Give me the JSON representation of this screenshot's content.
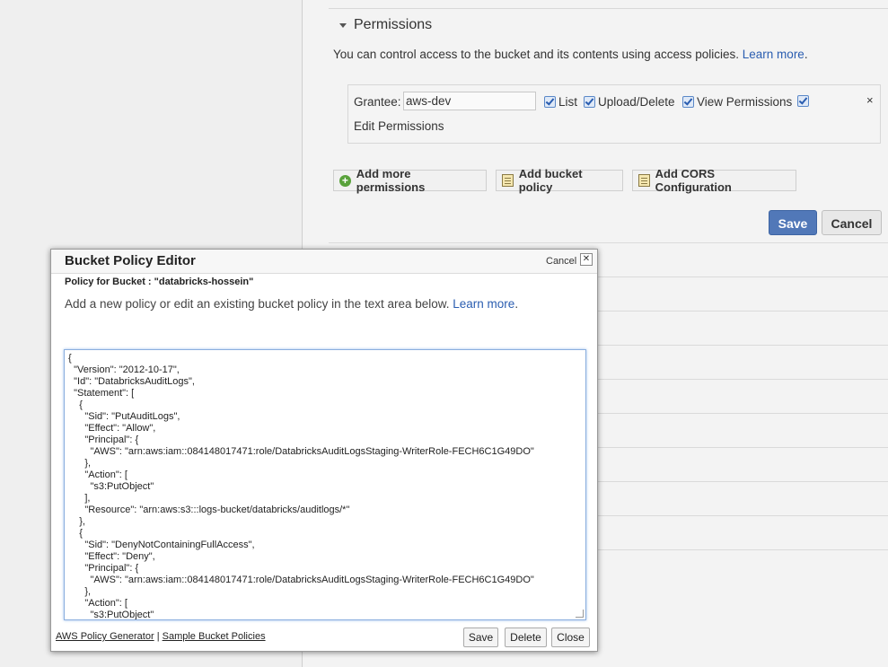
{
  "permissions": {
    "header": "Permissions",
    "description": "You can control access to the bucket and its contents using access policies.",
    "learn_more": "Learn more",
    "grantee": {
      "label": "Grantee:",
      "value": "aws-dev",
      "checkboxes": [
        {
          "label": "List",
          "checked": true
        },
        {
          "label": "Upload/Delete",
          "checked": true
        },
        {
          "label": "View Permissions",
          "checked": true
        },
        {
          "label": "Edit Permissions",
          "checked": true
        }
      ],
      "remove": "×"
    },
    "buttons": {
      "add_more": "Add more permissions",
      "add_policy": "Add bucket policy",
      "add_cors": "Add CORS Configuration",
      "save": "Save",
      "cancel": "Cancel"
    }
  },
  "modal": {
    "title": "Bucket Policy Editor",
    "cancel": "Cancel",
    "close_x": "✕",
    "policy_for": "Policy for Bucket : \"databricks-hossein\"",
    "description": "Add a new policy or edit an existing bucket policy in the text area below.",
    "learn_more": "Learn more",
    "policy_text": "{\n  \"Version\": \"2012-10-17\",\n  \"Id\": \"DatabricksAuditLogs\",\n  \"Statement\": [\n    {\n      \"Sid\": \"PutAuditLogs\",\n      \"Effect\": \"Allow\",\n      \"Principal\": {\n        \"AWS\": \"arn:aws:iam::084148017471:role/DatabricksAuditLogsStaging-WriterRole-FECH6C1G49DO\"\n      },\n      \"Action\": [\n        \"s3:PutObject\"\n      ],\n      \"Resource\": \"arn:aws:s3:::logs-bucket/databricks/auditlogs/*\"\n    },\n    {\n      \"Sid\": \"DenyNotContainingFullAccess\",\n      \"Effect\": \"Deny\",\n      \"Principal\": {\n        \"AWS\": \"arn:aws:iam::084148017471:role/DatabricksAuditLogsStaging-WriterRole-FECH6C1G49DO\"\n      },\n      \"Action\": [\n        \"s3:PutObject\"",
    "footer": {
      "policy_generator": "AWS Policy Generator",
      "separator": "|",
      "sample_policies": "Sample Bucket Policies"
    },
    "buttons": {
      "save": "Save",
      "delete": "Delete",
      "close": "Close"
    }
  },
  "colors": {
    "primary_button": "#5178b8",
    "link": "#2a5db0",
    "add_icon": "#59a23b"
  }
}
